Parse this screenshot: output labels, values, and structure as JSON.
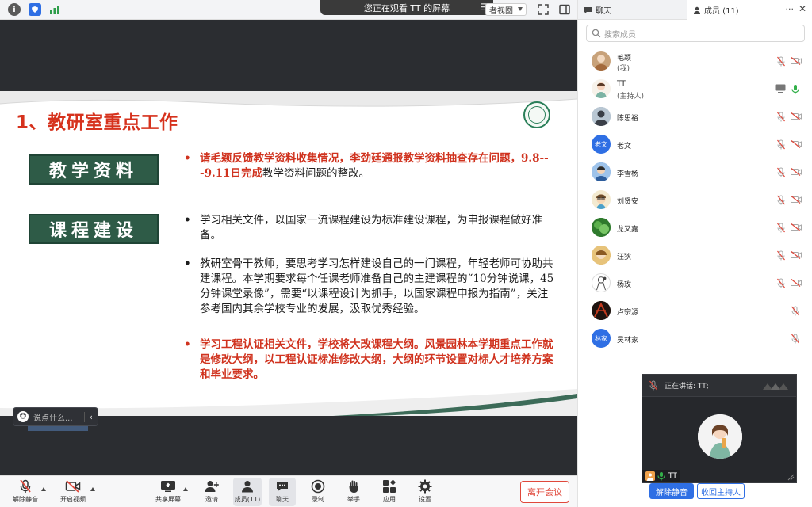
{
  "topbar": {
    "share_banner": "您正在观看 TT 的屏幕",
    "view_select": "者视图"
  },
  "slide": {
    "title": "1、教研室重点工作",
    "tags": [
      "教学资料",
      "课程建设"
    ],
    "bullet1": {
      "red_part": "请毛颖反馈教学资料收集情况，李劲廷通报教学资料抽查存在问题，9.8---9.11日完成",
      "black_part": "教学资料问题的整改。"
    },
    "bullet2": "学习相关文件，以国家一流课程建设为标准建设课程，为申报课程做好准备。",
    "bullet3": "教研室骨干教师，要思考学习怎样建设自己的一门课程，年轻老师可协助共建课程。本学期要求每个任课老师准备自己的主建课程的“10分钟说课，45分钟课堂录像”，需要“以课程设计为抓手，以国家课程申报为指南”，关注参考国内其余学校专业的发展，汲取优秀经验。",
    "bullet4": "学习工程认证相关文件，学校将大改课程大纲。风景园林本学期重点工作就是修改大纲，以工程认证标准修改大纲，大纲的环节设置对标人才培养方案和毕业要求。"
  },
  "chat_input": {
    "placeholder": "说点什么..."
  },
  "toolbar": {
    "unmute": "解除静音",
    "start_video": "开启视频",
    "share_screen": "共享屏幕",
    "invite": "邀请",
    "members": "成员(11)",
    "chat": "聊天",
    "record": "录制",
    "raise_hand": "举手",
    "apps": "应用",
    "settings": "设置",
    "leave": "离开会议"
  },
  "panel": {
    "tab_chat": "聊天",
    "tab_members": "成员 (11)",
    "search_placeholder": "搜索成员",
    "members": [
      {
        "name": "毛颖",
        "role": "(我)",
        "avatar": "photo",
        "color": "#c8a27a"
      },
      {
        "name": "TT",
        "role": "(主持人)",
        "avatar": "photo",
        "color": "#e6b8a0"
      },
      {
        "name": "陈思裕",
        "role": "",
        "avatar": "photo",
        "color": "#8fa6b8"
      },
      {
        "name": "老文",
        "role": "",
        "avatar": "老文",
        "color": "#2f6fe4"
      },
      {
        "name": "李雪杨",
        "role": "",
        "avatar": "photo",
        "color": "#5a8fd6"
      },
      {
        "name": "刘贤安",
        "role": "",
        "avatar": "photo",
        "color": "#d8c07a"
      },
      {
        "name": "龙又嘉",
        "role": "",
        "avatar": "photo",
        "color": "#3c8d3a"
      },
      {
        "name": "汪狄",
        "role": "",
        "avatar": "photo",
        "color": "#d4a548"
      },
      {
        "name": "杨玫",
        "role": "",
        "avatar": "photo",
        "color": "#cfcfcf"
      },
      {
        "name": "卢宗源",
        "role": "",
        "avatar": "photo",
        "color": "#8b2d1a"
      },
      {
        "name": "吴林家",
        "role": "",
        "avatar": "林家",
        "color": "#2f6fe4"
      }
    ],
    "speaking": "正在讲话: TT;",
    "speaker_name": "TT",
    "btn_unmute": "解除静音",
    "btn_reclaim_host": "收回主持人"
  },
  "colors": {
    "accent_blue": "#2f6fe4",
    "leave_red": "#e0483b",
    "slide_red": "#d0331f",
    "tag_green": "#2e5b47"
  }
}
